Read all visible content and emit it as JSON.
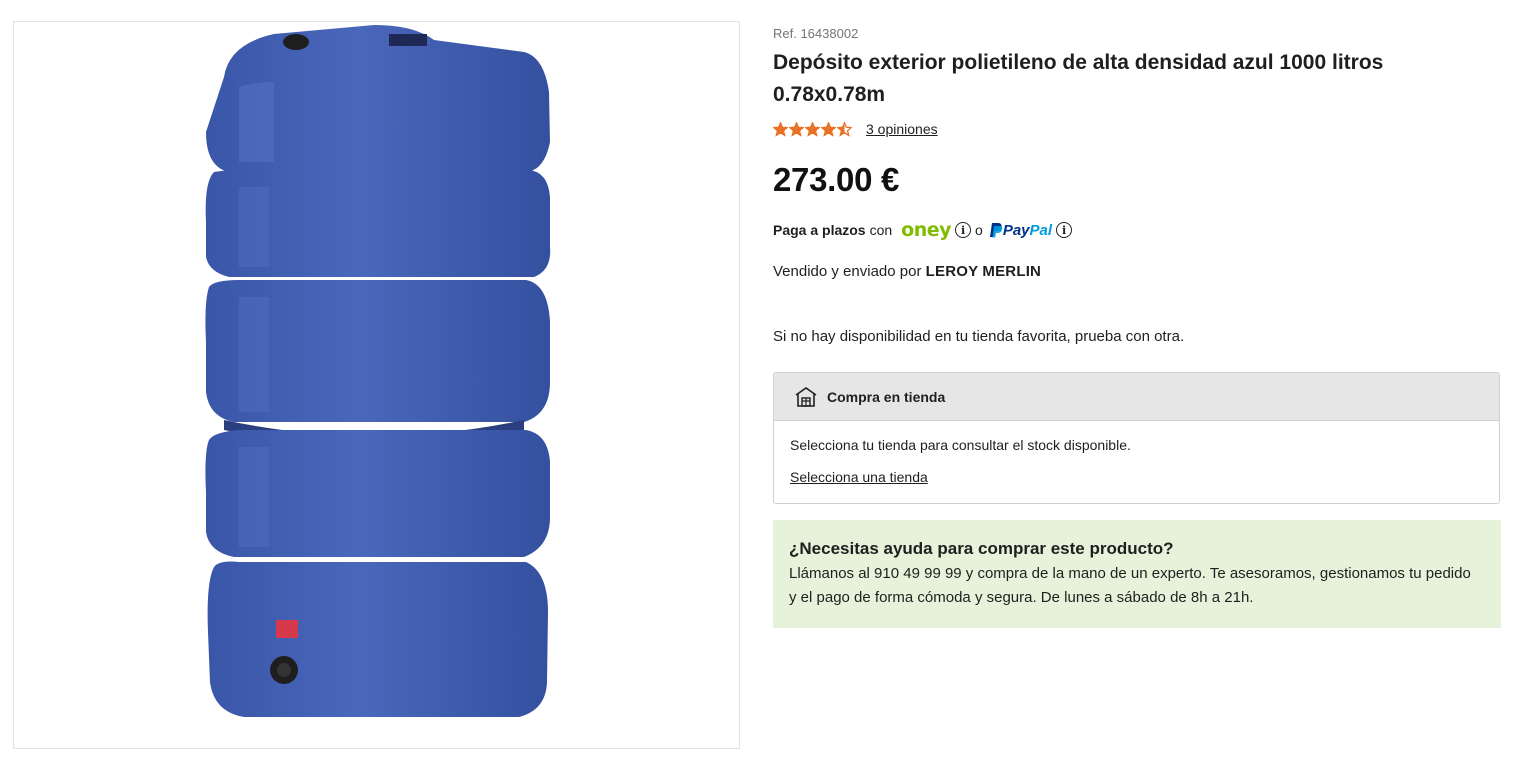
{
  "product": {
    "image": {
      "alt": "blue-water-tank-product-image",
      "colors": {
        "tank": "#3f5db0",
        "tank_dark": "#2e4590",
        "tank_light": "#5a78c8"
      }
    },
    "ref": "Ref. 16438002",
    "title": "Depósito exterior polietileno de alta densidad azul 1000 litros 0.78x0.78m",
    "rating": {
      "value": 4.5,
      "max": 5,
      "reviews_label": "3 opiniones",
      "star_color": "#ea7125"
    },
    "price": "273.00 €"
  },
  "payment": {
    "pay_label": "Paga a plazos",
    "with": "con",
    "oney": "oney",
    "or": "o",
    "paypal_pay": "Pay",
    "paypal_pal": "Pal",
    "info_glyph": "i"
  },
  "seller": {
    "prefix": "Vendido y enviado por",
    "name": "LEROY MERLIN"
  },
  "availability": "Si no hay disponibilidad en tu tienda favorita, prueba con otra.",
  "store": {
    "icon": "store-icon",
    "title": "Compra en tienda",
    "message": "Selecciona tu tienda para consultar el stock disponible.",
    "link": "Selecciona una tienda"
  },
  "help": {
    "title": "¿Necesitas ayuda para comprar este producto?",
    "text": "Llámanos al 910 49 99 99 y compra de la mano de un experto. Te asesoramos, gestionamos tu pedido y el pago de forma cómoda y segura. De lunes a sábado de 8h a 21h.",
    "background": "#e7f2da"
  }
}
